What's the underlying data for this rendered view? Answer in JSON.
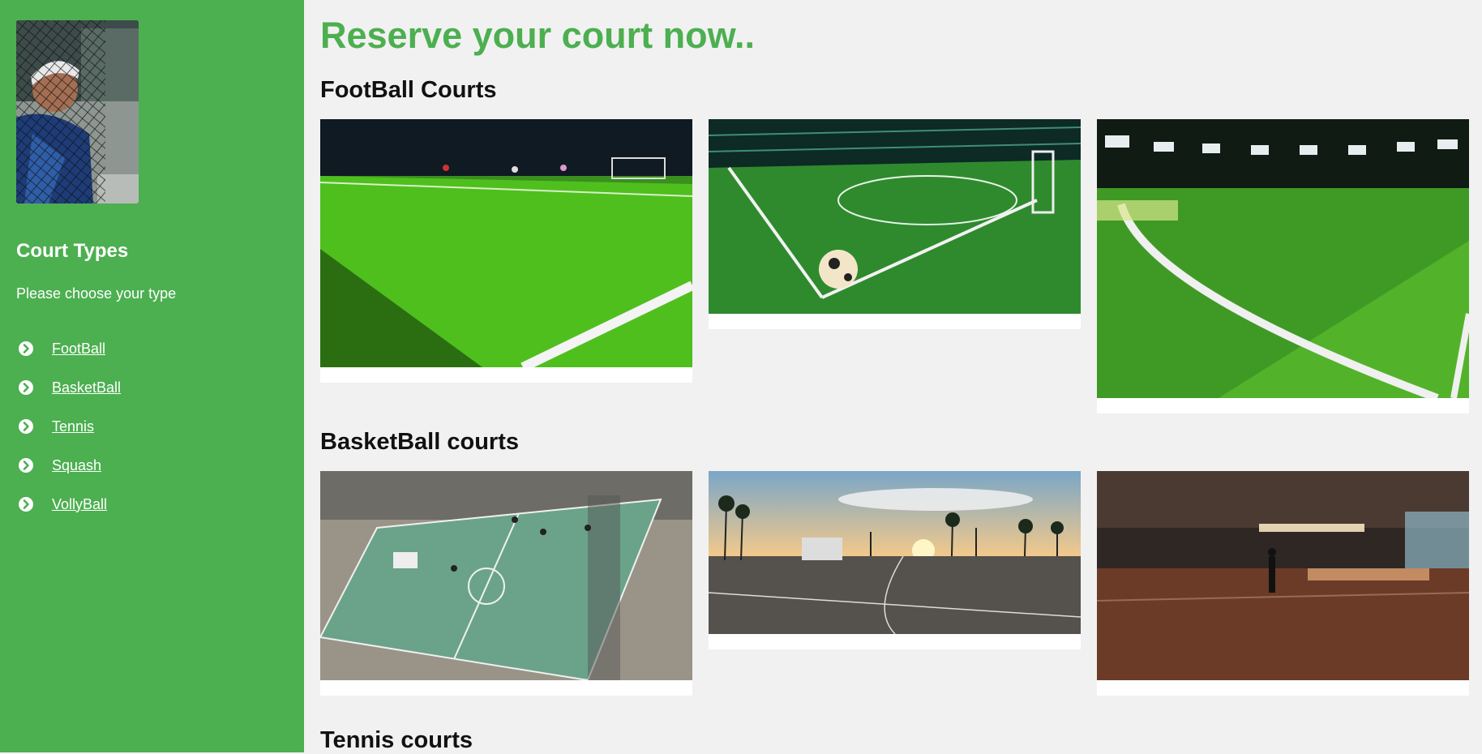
{
  "sidebar": {
    "title": "Court Types",
    "subtitle": "Please choose your type",
    "items": [
      {
        "label": "FootBall"
      },
      {
        "label": "BasketBall"
      },
      {
        "label": "Tennis"
      },
      {
        "label": "Squash"
      },
      {
        "label": "VollyBall"
      }
    ]
  },
  "main": {
    "title": "Reserve your court now..",
    "sections": [
      {
        "title": "FootBall Courts"
      },
      {
        "title": "BasketBall courts"
      },
      {
        "title": "Tennis courts"
      }
    ]
  },
  "colors": {
    "accent": "#4caf50",
    "background": "#f1f1f1"
  },
  "icons": {
    "nav": "chevron-circle-right-icon"
  }
}
